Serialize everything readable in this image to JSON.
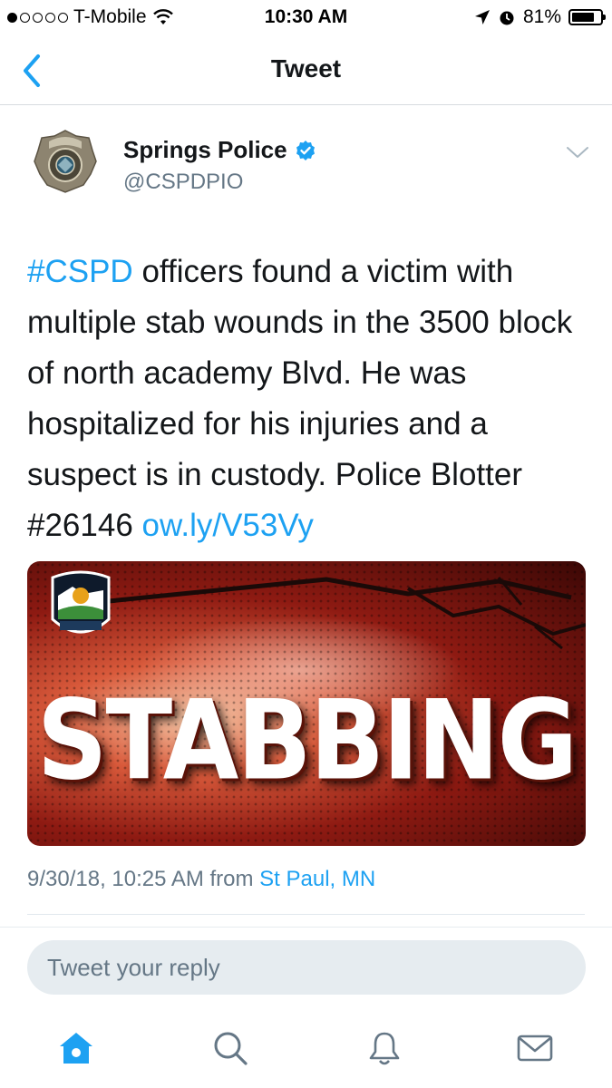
{
  "status_bar": {
    "carrier": "T-Mobile",
    "time": "10:30 AM",
    "battery": "81%",
    "battery_level": 0.81
  },
  "nav": {
    "title": "Tweet"
  },
  "tweet": {
    "author_name": "Springs Police",
    "handle": "@CSPDPIO",
    "hashtag": "#CSPD",
    "text_main": " officers found a victim with multiple stab wounds in the 3500 block of north academy Blvd. He was hospitalized for his injuries and a suspect is in custody. Police Blotter #26146 ",
    "link": "ow.ly/V53Vy",
    "media_text": "STABBING",
    "timestamp": "9/30/18, 10:25 AM from ",
    "location": "St Paul, MN"
  },
  "reply": {
    "placeholder": "Tweet your reply"
  },
  "colors": {
    "accent": "#1da1f2",
    "secondary_text": "#657786"
  },
  "tabs": [
    "home-icon",
    "search-icon",
    "bell-icon",
    "mail-icon"
  ]
}
